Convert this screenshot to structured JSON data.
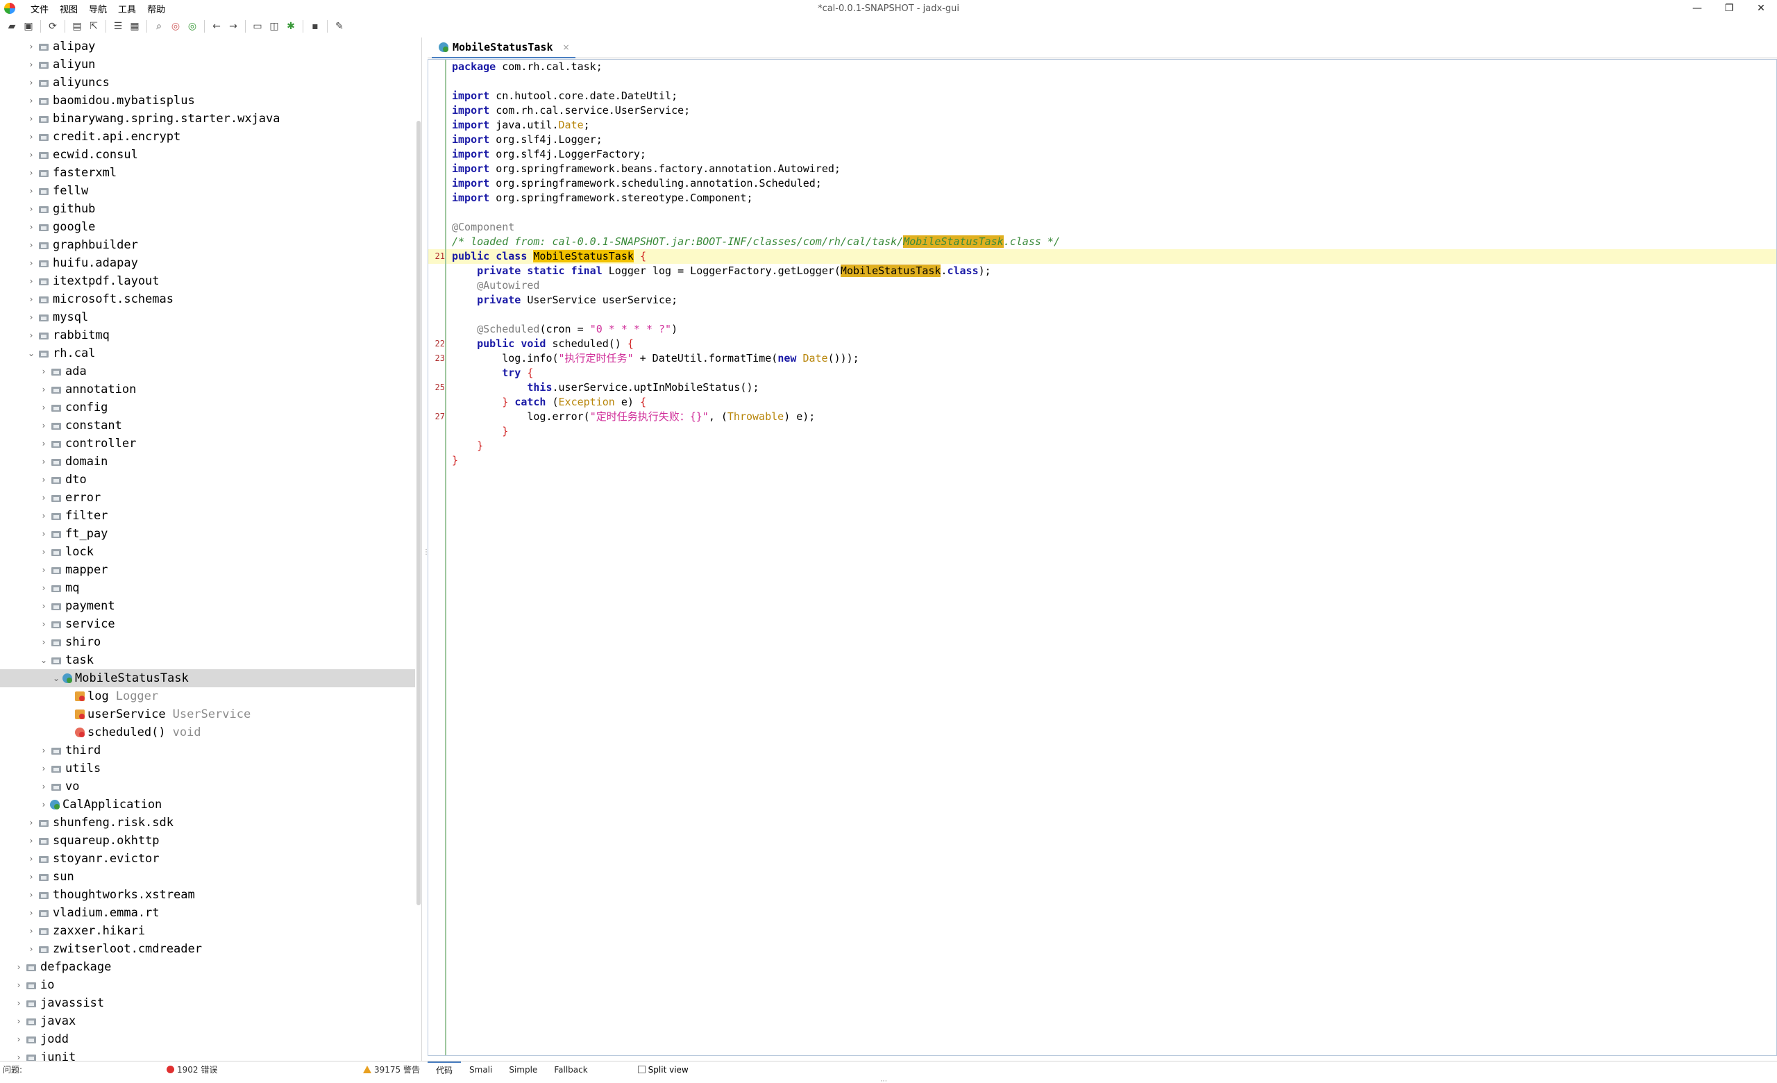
{
  "window": {
    "title": "*cal-0.0.1-SNAPSHOT - jadx-gui",
    "minimize": "—",
    "maximize": "❐",
    "close": "✕"
  },
  "menu": [
    "文件",
    "视图",
    "导航",
    "工具",
    "帮助"
  ],
  "tree": [
    {
      "label": "alipay",
      "type": "",
      "level": 2,
      "kind": "pkg",
      "exp": "collapsed"
    },
    {
      "label": "aliyun",
      "type": "",
      "level": 2,
      "kind": "pkg",
      "exp": "collapsed"
    },
    {
      "label": "aliyuncs",
      "type": "",
      "level": 2,
      "kind": "pkg",
      "exp": "collapsed"
    },
    {
      "label": "baomidou.mybatisplus",
      "type": "",
      "level": 2,
      "kind": "pkg",
      "exp": "collapsed"
    },
    {
      "label": "binarywang.spring.starter.wxjava",
      "type": "",
      "level": 2,
      "kind": "pkg",
      "exp": "collapsed"
    },
    {
      "label": "credit.api.encrypt",
      "type": "",
      "level": 2,
      "kind": "pkg",
      "exp": "collapsed"
    },
    {
      "label": "ecwid.consul",
      "type": "",
      "level": 2,
      "kind": "pkg",
      "exp": "collapsed"
    },
    {
      "label": "fasterxml",
      "type": "",
      "level": 2,
      "kind": "pkg",
      "exp": "collapsed"
    },
    {
      "label": "fellw",
      "type": "",
      "level": 2,
      "kind": "pkg",
      "exp": "collapsed"
    },
    {
      "label": "github",
      "type": "",
      "level": 2,
      "kind": "pkg",
      "exp": "collapsed"
    },
    {
      "label": "google",
      "type": "",
      "level": 2,
      "kind": "pkg",
      "exp": "collapsed"
    },
    {
      "label": "graphbuilder",
      "type": "",
      "level": 2,
      "kind": "pkg",
      "exp": "collapsed"
    },
    {
      "label": "huifu.adapay",
      "type": "",
      "level": 2,
      "kind": "pkg",
      "exp": "collapsed"
    },
    {
      "label": "itextpdf.layout",
      "type": "",
      "level": 2,
      "kind": "pkg",
      "exp": "collapsed"
    },
    {
      "label": "microsoft.schemas",
      "type": "",
      "level": 2,
      "kind": "pkg",
      "exp": "collapsed"
    },
    {
      "label": "mysql",
      "type": "",
      "level": 2,
      "kind": "pkg",
      "exp": "collapsed"
    },
    {
      "label": "rabbitmq",
      "type": "",
      "level": 2,
      "kind": "pkg",
      "exp": "collapsed"
    },
    {
      "label": "rh.cal",
      "type": "",
      "level": 2,
      "kind": "pkg",
      "exp": "expanded"
    },
    {
      "label": "ada",
      "type": "",
      "level": 3,
      "kind": "pkg",
      "exp": "collapsed"
    },
    {
      "label": "annotation",
      "type": "",
      "level": 3,
      "kind": "pkg",
      "exp": "collapsed"
    },
    {
      "label": "config",
      "type": "",
      "level": 3,
      "kind": "pkg",
      "exp": "collapsed"
    },
    {
      "label": "constant",
      "type": "",
      "level": 3,
      "kind": "pkg",
      "exp": "collapsed"
    },
    {
      "label": "controller",
      "type": "",
      "level": 3,
      "kind": "pkg",
      "exp": "collapsed"
    },
    {
      "label": "domain",
      "type": "",
      "level": 3,
      "kind": "pkg",
      "exp": "collapsed"
    },
    {
      "label": "dto",
      "type": "",
      "level": 3,
      "kind": "pkg",
      "exp": "collapsed"
    },
    {
      "label": "error",
      "type": "",
      "level": 3,
      "kind": "pkg",
      "exp": "collapsed"
    },
    {
      "label": "filter",
      "type": "",
      "level": 3,
      "kind": "pkg",
      "exp": "collapsed"
    },
    {
      "label": "ft_pay",
      "type": "",
      "level": 3,
      "kind": "pkg",
      "exp": "collapsed"
    },
    {
      "label": "lock",
      "type": "",
      "level": 3,
      "kind": "pkg",
      "exp": "collapsed"
    },
    {
      "label": "mapper",
      "type": "",
      "level": 3,
      "kind": "pkg",
      "exp": "collapsed"
    },
    {
      "label": "mq",
      "type": "",
      "level": 3,
      "kind": "pkg",
      "exp": "collapsed"
    },
    {
      "label": "payment",
      "type": "",
      "level": 3,
      "kind": "pkg",
      "exp": "collapsed"
    },
    {
      "label": "service",
      "type": "",
      "level": 3,
      "kind": "pkg",
      "exp": "collapsed"
    },
    {
      "label": "shiro",
      "type": "",
      "level": 3,
      "kind": "pkg",
      "exp": "collapsed"
    },
    {
      "label": "task",
      "type": "",
      "level": 3,
      "kind": "pkg",
      "exp": "expanded"
    },
    {
      "label": "MobileStatusTask",
      "type": "",
      "level": 4,
      "kind": "cls",
      "exp": "expanded",
      "selected": true
    },
    {
      "label": "log",
      "type": "Logger",
      "level": 5,
      "kind": "fld",
      "exp": "none"
    },
    {
      "label": "userService",
      "type": "UserService",
      "level": 5,
      "kind": "fld",
      "exp": "none"
    },
    {
      "label": "scheduled()",
      "type": "void",
      "level": 5,
      "kind": "mth",
      "exp": "none"
    },
    {
      "label": "third",
      "type": "",
      "level": 3,
      "kind": "pkg",
      "exp": "collapsed"
    },
    {
      "label": "utils",
      "type": "",
      "level": 3,
      "kind": "pkg",
      "exp": "collapsed"
    },
    {
      "label": "vo",
      "type": "",
      "level": 3,
      "kind": "pkg",
      "exp": "collapsed"
    },
    {
      "label": "CalApplication",
      "type": "",
      "level": 3,
      "kind": "cls",
      "exp": "collapsed"
    },
    {
      "label": "shunfeng.risk.sdk",
      "type": "",
      "level": 2,
      "kind": "pkg",
      "exp": "collapsed"
    },
    {
      "label": "squareup.okhttp",
      "type": "",
      "level": 2,
      "kind": "pkg",
      "exp": "collapsed"
    },
    {
      "label": "stoyanr.evictor",
      "type": "",
      "level": 2,
      "kind": "pkg",
      "exp": "collapsed"
    },
    {
      "label": "sun",
      "type": "",
      "level": 2,
      "kind": "pkg",
      "exp": "collapsed"
    },
    {
      "label": "thoughtworks.xstream",
      "type": "",
      "level": 2,
      "kind": "pkg",
      "exp": "collapsed"
    },
    {
      "label": "vladium.emma.rt",
      "type": "",
      "level": 2,
      "kind": "pkg",
      "exp": "collapsed"
    },
    {
      "label": "zaxxer.hikari",
      "type": "",
      "level": 2,
      "kind": "pkg",
      "exp": "collapsed"
    },
    {
      "label": "zwitserloot.cmdreader",
      "type": "",
      "level": 2,
      "kind": "pkg",
      "exp": "collapsed"
    },
    {
      "label": "defpackage",
      "type": "",
      "level": 1,
      "kind": "pkg",
      "exp": "collapsed"
    },
    {
      "label": "io",
      "type": "",
      "level": 1,
      "kind": "pkg",
      "exp": "collapsed"
    },
    {
      "label": "javassist",
      "type": "",
      "level": 1,
      "kind": "pkg",
      "exp": "collapsed"
    },
    {
      "label": "javax",
      "type": "",
      "level": 1,
      "kind": "pkg",
      "exp": "collapsed"
    },
    {
      "label": "jodd",
      "type": "",
      "level": 1,
      "kind": "pkg",
      "exp": "collapsed"
    },
    {
      "label": "junit",
      "type": "",
      "level": 1,
      "kind": "pkg",
      "exp": "collapsed"
    }
  ],
  "editor": {
    "tab_label": "MobileStatusTask",
    "tab_close": "×",
    "code": [
      {
        "n": "",
        "html": "<span class=\"kw\">package</span> com.rh.cal.task;"
      },
      {
        "n": "",
        "html": ""
      },
      {
        "n": "",
        "html": "<span class=\"kw\">import</span> cn.hutool.core.date.DateUtil;"
      },
      {
        "n": "",
        "html": "<span class=\"kw\">import</span> com.rh.cal.service.UserService;"
      },
      {
        "n": "",
        "html": "<span class=\"kw\">import</span> java.util.<span class=\"cls\">Date</span>;"
      },
      {
        "n": "",
        "html": "<span class=\"kw\">import</span> org.slf4j.Logger;"
      },
      {
        "n": "",
        "html": "<span class=\"kw\">import</span> org.slf4j.LoggerFactory;"
      },
      {
        "n": "",
        "html": "<span class=\"kw\">import</span> org.springframework.beans.factory.annotation.Autowired;"
      },
      {
        "n": "",
        "html": "<span class=\"kw\">import</span> org.springframework.scheduling.annotation.Scheduled;"
      },
      {
        "n": "",
        "html": "<span class=\"kw\">import</span> org.springframework.stereotype.Component;"
      },
      {
        "n": "",
        "html": ""
      },
      {
        "n": "",
        "html": "<span class=\"ann\">@Component</span>"
      },
      {
        "n": "",
        "html": "<span class=\"cmt\">/* loaded from: cal-0.0.1-SNAPSHOT.jar:BOOT-INF/classes/com/rh/cal/task/<span class=\"mark2\">MobileStatusTask</span>.class */</span>"
      },
      {
        "n": "21",
        "html": "<span class=\"kw\">public class</span> <span class=\"mark\">MobileStatusTask</span> <span class=\"brace\">{</span>"
      },
      {
        "n": "",
        "html": "    <span class=\"kw\">private static final</span> Logger log = LoggerFactory.getLogger(<span class=\"mark2\">MobileStatusTask</span>.<span class=\"kw\">class</span>);"
      },
      {
        "n": "",
        "html": "    <span class=\"ann\">@Autowired</span>"
      },
      {
        "n": "",
        "html": "    <span class=\"kw\">private</span> UserService userService;"
      },
      {
        "n": "",
        "html": ""
      },
      {
        "n": "",
        "html": "    <span class=\"ann\">@Scheduled</span>(cron = <span class=\"str\">\"0 * * * * ?\"</span>)"
      },
      {
        "n": "22",
        "html": "    <span class=\"kw\">public void</span> scheduled() <span class=\"brace\">{</span>"
      },
      {
        "n": "23",
        "html": "        log.info(<span class=\"str\">\"执行定时任务\"</span> + DateUtil.formatTime(<span class=\"kw\">new</span> <span class=\"cls\">Date</span>()));"
      },
      {
        "n": "",
        "html": "        <span class=\"kw\">try</span> <span class=\"brace\">{</span>"
      },
      {
        "n": "25",
        "html": "            <span class=\"kw\">this</span>.userService.uptInMobileStatus();"
      },
      {
        "n": "",
        "html": "        <span class=\"brace\">}</span> <span class=\"kw\">catch</span> (<span class=\"cls\">Exception</span> e) <span class=\"brace\">{</span>"
      },
      {
        "n": "27",
        "html": "            log.error(<span class=\"str\">\"定时任务执行失败：{}\"</span>, (<span class=\"cls\">Throwable</span>) e);"
      },
      {
        "n": "",
        "html": "        <span class=\"brace\">}</span>"
      },
      {
        "n": "",
        "html": "    <span class=\"brace\">}</span>"
      },
      {
        "n": "",
        "html": "<span class=\"brace\">}</span>"
      }
    ]
  },
  "status": {
    "issues_label": "问题:",
    "errors": "1902 错误",
    "warnings": "39175 警告",
    "bottom_tabs": [
      "代码",
      "Smali",
      "Simple",
      "Fallback"
    ],
    "split_view": "Split view"
  },
  "colors": {
    "keyword": "#1a1aa6",
    "string": "#d0309a",
    "comment": "#3a8a3a",
    "highlight": "#f2c200",
    "current_line": "#fdfac8",
    "accent": "#4a7fc2"
  }
}
